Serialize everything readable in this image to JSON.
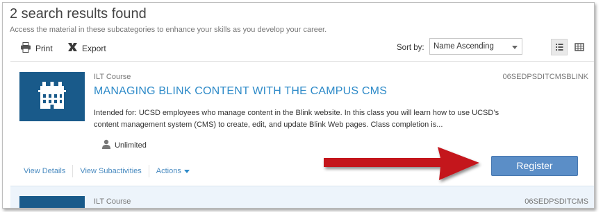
{
  "header": {
    "title": "2 search results found",
    "subtitle": "Access the material in these subcategories to enhance your skills as you develop your career."
  },
  "toolbar": {
    "print_label": "Print",
    "export_label": "Export",
    "sort_label": "Sort by:",
    "sort_value": "Name Ascending",
    "print_icon": "printer-icon",
    "export_icon": "excel-icon",
    "list_view_icon": "list-view-icon",
    "grid_view_icon": "grid-view-icon"
  },
  "results": [
    {
      "type": "ILT Course",
      "code": "06SEDPSDITCMSBLINK",
      "title": "MANAGING BLINK CONTENT WITH THE CAMPUS CMS",
      "description": "Intended for: UCSD employees who manage content in the Blink website. In this class you will learn how to use UCSD’s content management system (CMS) to create, edit, and update Blink Web pages. Class completion is...",
      "availability": "Unlimited",
      "links": {
        "view_details": "View Details",
        "view_subactivities": "View Subactivities",
        "actions": "Actions"
      },
      "register_label": "Register"
    },
    {
      "type": "ILT Course",
      "code": "06SEDPSDITCMS"
    }
  ],
  "colors": {
    "accent": "#2d8ac8",
    "image_bg": "#195a8a",
    "register_bg": "#5b8ec7",
    "annotation_arrow": "#c4141c"
  }
}
